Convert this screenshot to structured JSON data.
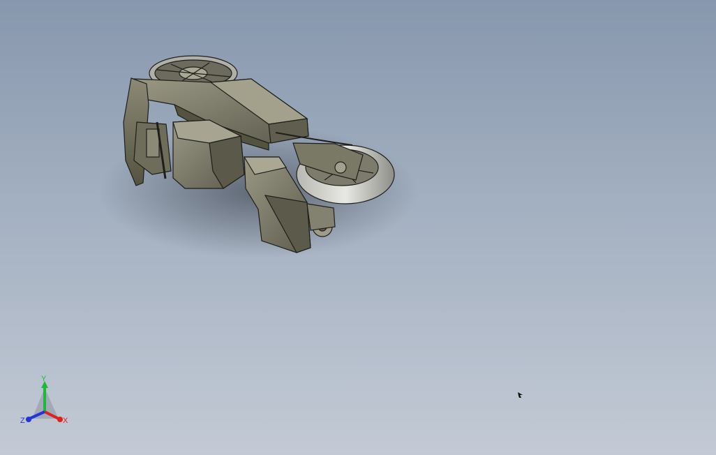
{
  "viewport": {
    "background_top": "#8797ad",
    "background_bottom": "#c3cad5"
  },
  "model": {
    "icon": "motorcycle-cad-model",
    "body_color": "#7a7866",
    "edge_color": "#1e1e1a"
  },
  "triad": {
    "x_label": "X",
    "y_label": "Y",
    "z_label": "Z",
    "x_color": "#e0201a",
    "y_color": "#1fb83a",
    "z_color": "#2435d8"
  },
  "cursor": {
    "icon": "mouse-cursor-icon"
  }
}
